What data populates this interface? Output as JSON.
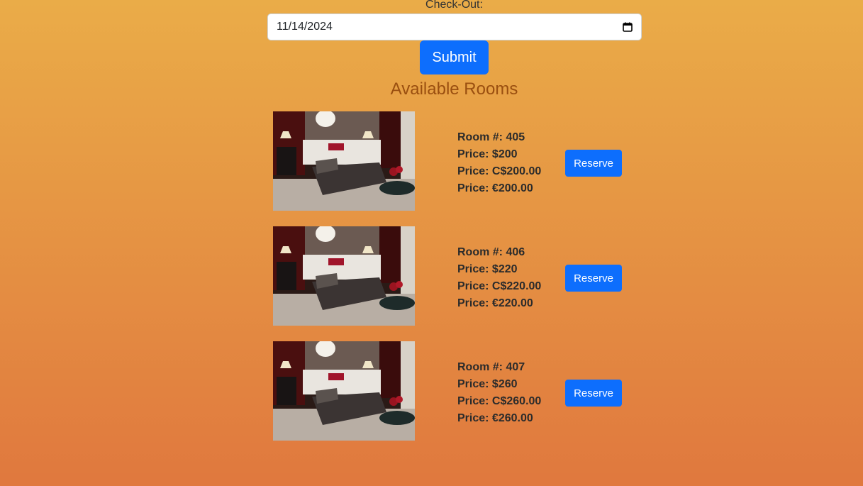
{
  "form": {
    "checkout_label": "Check-Out:",
    "checkout_value": "11/14/2024",
    "submit_label": "Submit"
  },
  "available_rooms_title": "Available Rooms",
  "rooms": [
    {
      "room_label": "Room #: 405",
      "price_usd": "Price: $200",
      "price_cad": "Price: C$200.00",
      "price_eur": "Price: €200.00",
      "reserve_label": "Reserve"
    },
    {
      "room_label": "Room #: 406",
      "price_usd": "Price: $220",
      "price_cad": "Price: C$220.00",
      "price_eur": "Price: €220.00",
      "reserve_label": "Reserve"
    },
    {
      "room_label": "Room #: 407",
      "price_usd": "Price: $260",
      "price_cad": "Price: C$260.00",
      "price_eur": "Price: €260.00",
      "reserve_label": "Reserve"
    }
  ],
  "colors": {
    "primary_button": "#0d6efd",
    "title": "#9a4f10",
    "background_top": "#eaac48",
    "background_bottom": "#e0783e"
  },
  "icons": {
    "date_picker": "calendar-icon"
  }
}
